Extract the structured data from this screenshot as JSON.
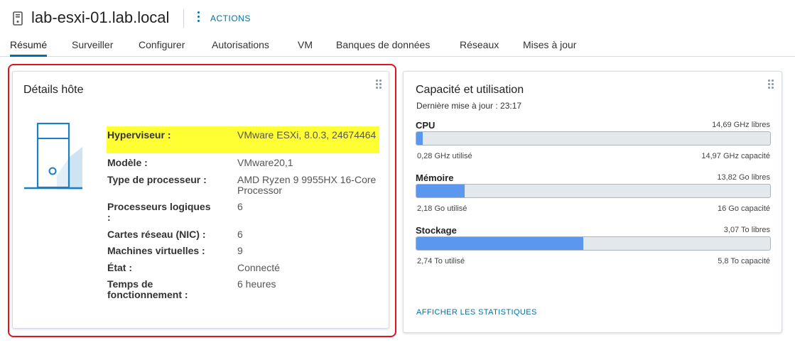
{
  "header": {
    "title": "lab-esxi-01.lab.local",
    "actions_label": "ACTIONS"
  },
  "tabs": [
    {
      "label": "Résumé",
      "active": true
    },
    {
      "label": "Surveiller"
    },
    {
      "label": "Configurer"
    },
    {
      "label": "Autorisations"
    },
    {
      "label": "VM"
    },
    {
      "label": "Banques de données"
    },
    {
      "label": "Réseaux"
    },
    {
      "label": "Mises à jour"
    }
  ],
  "host_details": {
    "title": "Détails hôte",
    "rows": [
      {
        "label": "Hyperviseur :",
        "value": "VMware ESXi, 8.0.3, 24674464"
      },
      {
        "label": "Modèle :",
        "value": "VMware20,1"
      },
      {
        "label": "Type de processeur :",
        "value": "AMD Ryzen 9 9955HX 16-Core Processor"
      },
      {
        "label": "Processeurs logiques :",
        "value": "6"
      },
      {
        "label": "Cartes réseau (NIC) :",
        "value": "6"
      },
      {
        "label": "Machines virtuelles :",
        "value": "9"
      },
      {
        "label": "État :",
        "value": "Connecté"
      },
      {
        "label": "Temps de fonctionnement :",
        "value": "6 heures"
      }
    ]
  },
  "capacity": {
    "title": "Capacité et utilisation",
    "last_update": "Dernière mise à jour : 23:17",
    "metrics": [
      {
        "name": "CPU",
        "free": "14,69 GHz libres",
        "used": "0,28 GHz utilisé",
        "capacity": "14,97 GHz capacité",
        "fraction": 0.019
      },
      {
        "name": "Mémoire",
        "free": "13,82 Go libres",
        "used": "2,18 Go utilisé",
        "capacity": "16 Go capacité",
        "fraction": 0.136
      },
      {
        "name": "Stockage",
        "free": "3,07 To libres",
        "used": "2,74 To utilisé",
        "capacity": "5,8 To capacité",
        "fraction": 0.472
      }
    ],
    "stats_link": "AFFICHER LES STATISTIQUES"
  },
  "colors": {
    "accent": "#0072a3",
    "bar_fill": "#5b97ee",
    "highlight": "#ffff33",
    "annotation_outline": "#e0141e"
  },
  "icons": [
    "host-icon",
    "kebab-menu-icon",
    "drag-handle-icon",
    "server-illustration"
  ]
}
